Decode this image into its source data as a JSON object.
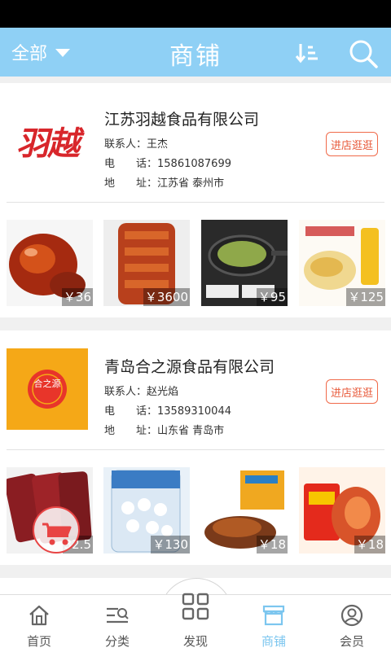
{
  "header": {
    "category_label": "全部",
    "title": "商铺"
  },
  "shops": [
    {
      "name": "江苏羽越食品有限公司",
      "logo_text": "羽越",
      "contact_label": "联系人：",
      "contact": "王杰",
      "phone_label": "电　　话：",
      "phone": "15861087699",
      "address_label": "地　　址：",
      "address": "江苏省 泰州市",
      "visit_label": "进店逛逛",
      "products": [
        {
          "price": "￥36"
        },
        {
          "price": "￥3600"
        },
        {
          "price": "￥95"
        },
        {
          "price": "￥125"
        }
      ]
    },
    {
      "name": "青岛合之源食品有限公司",
      "logo_text": "合之源",
      "contact_label": "联系人：",
      "contact": "赵光焰",
      "phone_label": "电　　话：",
      "phone": "13589310044",
      "address_label": "地　　址：",
      "address": "山东省 青岛市",
      "visit_label": "进店逛逛",
      "products": [
        {
          "price": "32.5"
        },
        {
          "price": "￥130"
        },
        {
          "price": "￥18"
        },
        {
          "price": "￥18"
        }
      ]
    }
  ],
  "tabbar": {
    "home": "首页",
    "category": "分类",
    "discover": "发现",
    "shops": "商铺",
    "member": "会员"
  },
  "colors": {
    "header": "#8fd0f5",
    "button_border": "#f06a4a",
    "active_tab": "#7cc6ef"
  }
}
